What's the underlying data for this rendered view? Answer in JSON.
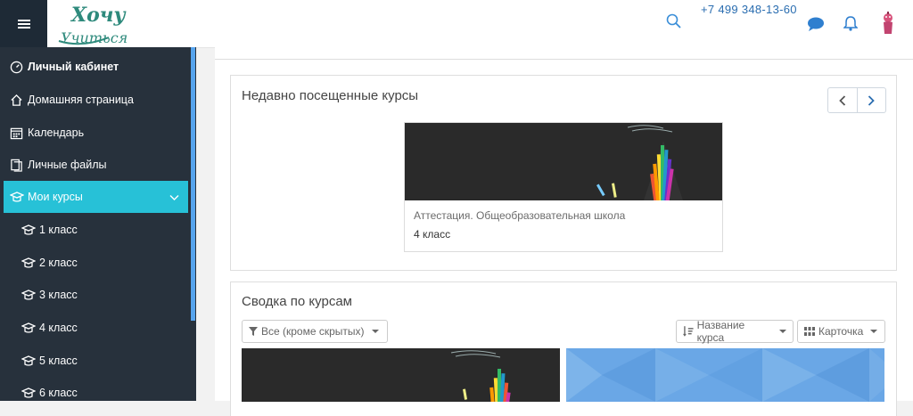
{
  "header": {
    "phone": "+7 499 348-13-60",
    "logo_text_line1": "Хочу",
    "logo_text_line2": "Учиться",
    "icons": [
      "menu-icon",
      "search-icon",
      "chat-icon",
      "bell-icon",
      "avatar"
    ],
    "accent_color": "#27c1d7",
    "link_color": "#2a6db0"
  },
  "sidebar": {
    "items": [
      {
        "label": "Личный кабинет",
        "icon": "dashboard-icon"
      },
      {
        "label": "Домашняя страница",
        "icon": "home-icon"
      },
      {
        "label": "Календарь",
        "icon": "calendar-icon"
      },
      {
        "label": "Личные файлы",
        "icon": "files-icon"
      },
      {
        "label": "Мои курсы",
        "icon": "graduation-cap-icon"
      },
      {
        "label": "1 класс",
        "icon": "graduation-cap-icon"
      },
      {
        "label": "2 класс",
        "icon": "graduation-cap-icon"
      },
      {
        "label": "3 класс",
        "icon": "graduation-cap-icon"
      },
      {
        "label": "4 класс",
        "icon": "graduation-cap-icon"
      },
      {
        "label": "5 класс",
        "icon": "graduation-cap-icon"
      },
      {
        "label": "6 класс",
        "icon": "graduation-cap-icon"
      }
    ],
    "active_item": "Мои курсы",
    "background": "#27313c"
  },
  "recent": {
    "title": "Недавно посещенные курсы",
    "course": {
      "category": "Аттестация. Общеобразовательная школа",
      "name": "4 класс"
    }
  },
  "overview": {
    "title": "Сводка по курсам",
    "filter_label": "Все (кроме скрытых)",
    "sort_label": "Название курса",
    "view_label": "Карточка"
  }
}
